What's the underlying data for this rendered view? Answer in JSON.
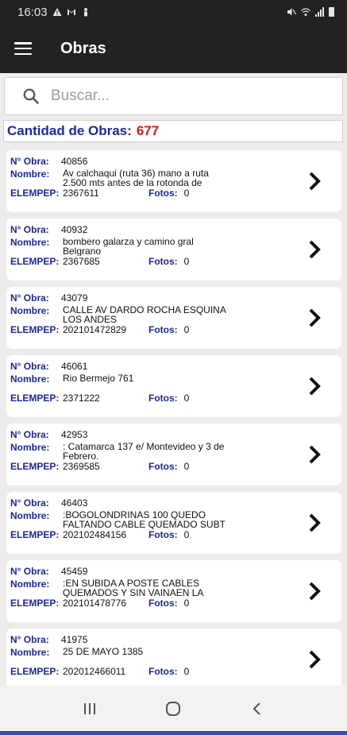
{
  "status_bar": {
    "time": "16:03",
    "left_icons": [
      "warning-icon",
      "gmail-icon",
      "person-icon"
    ],
    "right_icons": [
      "mute-icon",
      "wifi-icon",
      "signal-icon",
      "battery-icon"
    ]
  },
  "app_bar": {
    "title": "Obras",
    "menu_icon": "hamburger-menu-icon"
  },
  "search": {
    "placeholder": "Buscar...",
    "value": ""
  },
  "count": {
    "label": "Cantidad de Obras:",
    "value": "677"
  },
  "labels": {
    "obra": "N° Obra:",
    "nombre": "Nombre:",
    "elempep": "ELEMPEP:",
    "fotos": "Fotos:"
  },
  "obras": [
    {
      "numero": "40856",
      "nombre": "Av calchaqui (ruta 36) mano a ruta 2.500 mts antes de la rotonda de",
      "elempep": "2367611",
      "fotos": "0"
    },
    {
      "numero": "40932",
      "nombre": " bombero galarza y camino gral Belgrano",
      "elempep": "2367685",
      "fotos": "0"
    },
    {
      "numero": "43079",
      "nombre": "CALLE AV DARDO ROCHA ESQUINA LOS ANDES",
      "elempep": "202101472829",
      "fotos": "0"
    },
    {
      "numero": "46061",
      "nombre": " Rio Bermejo 761",
      "elempep": "2371222",
      "fotos": "0"
    },
    {
      "numero": "42953",
      "nombre": ": Catamarca 137 e/ Montevideo y 3 de Febrero.",
      "elempep": "2369585",
      "fotos": "0"
    },
    {
      "numero": "46403",
      "nombre": ":BOGOLONDRINAS 100   QUEDO FALTANDO   CABLE QUEMADO SUBT",
      "elempep": "202102484156",
      "fotos": "0"
    },
    {
      "numero": "45459",
      "nombre": ":EN SUBIDA A POSTE CABLES QUEMADOS Y SIN VAINAEN LA CALLE",
      "elempep": "202101478776",
      "fotos": "0"
    },
    {
      "numero": "41975",
      "nombre": "25 DE MAYO 1385",
      "elempep": "202012466011",
      "fotos": "0"
    }
  ],
  "nav_bar": {
    "icons": [
      "recent-apps-icon",
      "home-icon",
      "back-icon"
    ]
  },
  "colors": {
    "label_blue": "#1c2796",
    "count_red": "#d21a1a",
    "app_bar": "#222222",
    "accent_strip": "#3f4ba8"
  }
}
